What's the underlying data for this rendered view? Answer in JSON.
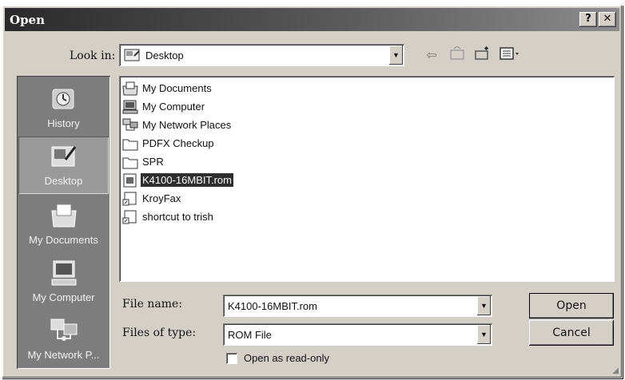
{
  "window": {
    "title": "Open",
    "help_glyph": "?",
    "close_glyph": "✕"
  },
  "lookin": {
    "label": "Look in:",
    "value": "Desktop"
  },
  "toolbar": {
    "icons": [
      "back-arrow-icon",
      "up-folder-icon",
      "new-folder-icon",
      "view-menu-icon"
    ]
  },
  "places": [
    {
      "label": "History",
      "icon": "history-icon"
    },
    {
      "label": "Desktop",
      "icon": "desktop-icon",
      "active": true
    },
    {
      "label": "My Documents",
      "icon": "my-documents-icon"
    },
    {
      "label": "My Computer",
      "icon": "my-computer-icon"
    },
    {
      "label": "My Network P...",
      "icon": "my-network-icon"
    }
  ],
  "files": [
    {
      "name": "My Documents",
      "icon": "my-documents-icon"
    },
    {
      "name": "My Computer",
      "icon": "computer-icon"
    },
    {
      "name": "My Network Places",
      "icon": "network-icon"
    },
    {
      "name": "PDFX Checkup",
      "icon": "folder-icon"
    },
    {
      "name": "SPR",
      "icon": "folder-icon"
    },
    {
      "name": "K4100-16MBIT.rom",
      "icon": "rom-file-icon",
      "selected": true
    },
    {
      "name": "KroyFax",
      "icon": "shortcut-icon"
    },
    {
      "name": "shortcut to trish",
      "icon": "shortcut-icon"
    }
  ],
  "form": {
    "filename_label": "File name:",
    "filename_value": "K4100-16MBIT.rom",
    "filetype_label": "Files of type:",
    "filetype_value": "ROM File",
    "readonly_label": "Open as read-only"
  },
  "buttons": {
    "open": "Open",
    "cancel": "Cancel"
  }
}
